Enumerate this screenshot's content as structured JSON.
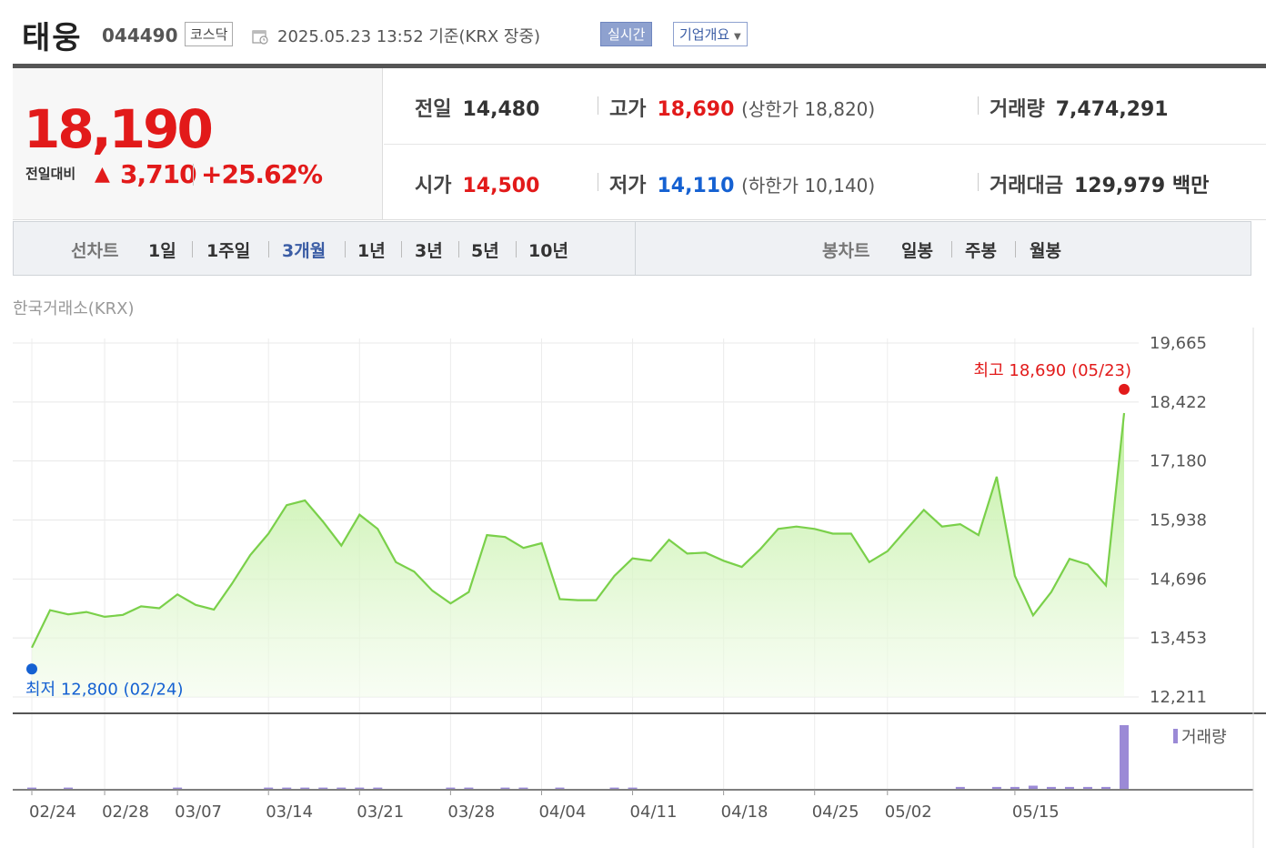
{
  "header": {
    "name": "태웅",
    "code": "044490",
    "market": "코스닥",
    "datetime": "2025.05.23 13:52  기준(KRX 장중)",
    "realtime_label": "실시간",
    "overview_label": "기업개요",
    "icons": [
      "calendar-icon",
      "dropdown-caret-icon"
    ]
  },
  "price": {
    "current": "18,190",
    "compare_label": "전일대비",
    "direction": "up",
    "change": "3,710",
    "rate": "+25.62%"
  },
  "stats": {
    "prev_label": "전일",
    "prev": "14,480",
    "high_label": "고가",
    "high": "18,690",
    "upper_limit": "(상한가 18,820)",
    "volume_label": "거래량",
    "volume": "7,474,291",
    "open_label": "시가",
    "open": "14,500",
    "low_label": "저가",
    "low": "14,110",
    "lower_limit": "(하한가 10,140)",
    "amount_label": "거래대금",
    "amount": "129,979",
    "amount_unit": "백만"
  },
  "line_chart_tabs": {
    "label": "선차트",
    "items": [
      "1일",
      "1주일",
      "3개월",
      "1년",
      "3년",
      "5년",
      "10년"
    ],
    "active": "3개월"
  },
  "candle_chart_tabs": {
    "label": "봉차트",
    "items": [
      "일봉",
      "주봉",
      "월봉"
    ]
  },
  "exchange_label": "한국거래소(KRX)",
  "colors": {
    "up": "#e21a1a",
    "down": "#1561d2",
    "line": "#7ad04a",
    "volume": "#9b8ad6",
    "active_tab": "#3b5da5"
  },
  "chart_data": {
    "type": "line",
    "y_ticks": [
      "19,665",
      "18,422",
      "17,180",
      "15,938",
      "14,696",
      "13,453",
      "12,211"
    ],
    "ylim": [
      12211,
      19665
    ],
    "x_ticks": [
      "02/24",
      "02/28",
      "03/07",
      "03/14",
      "03/21",
      "03/28",
      "04/04",
      "04/11",
      "04/18",
      "04/25",
      "05/02",
      "05/15"
    ],
    "x_tick_index": [
      0,
      4,
      8,
      13,
      18,
      23,
      28,
      33,
      38,
      43,
      47,
      54
    ],
    "max_annotation": "최고 18,690 (05/23)",
    "min_annotation": "최저 12,800 (02/24)",
    "max_value": 18690,
    "min_value": 12800,
    "values": [
      13250,
      14040,
      13950,
      14000,
      13900,
      13940,
      14120,
      14080,
      14370,
      14150,
      14050,
      14600,
      15200,
      15650,
      16250,
      16350,
      15900,
      15400,
      16050,
      15750,
      15050,
      14850,
      14450,
      14180,
      14420,
      15620,
      15580,
      15350,
      15450,
      14270,
      14250,
      14250,
      14760,
      15130,
      15080,
      15520,
      15230,
      15250,
      15080,
      14950,
      15320,
      15750,
      15800,
      15750,
      15650,
      15650,
      15050,
      15280,
      15720,
      16150,
      15800,
      15850,
      15620,
      16850,
      14760,
      13930,
      14420,
      15120,
      15000,
      14560,
      18190
    ],
    "volume_label": "거래량",
    "volume": [
      0.02,
      0,
      0.02,
      0,
      0,
      0,
      0,
      0,
      0.02,
      0,
      0,
      0,
      0,
      0.02,
      0.02,
      0.02,
      0.02,
      0.02,
      0.02,
      0.02,
      0,
      0,
      0,
      0.02,
      0.02,
      0,
      0.02,
      0.02,
      0,
      0.02,
      0,
      0,
      0.02,
      0.02,
      0,
      0,
      0,
      0,
      0,
      0,
      0,
      0,
      0,
      0,
      0,
      0,
      0,
      0,
      0,
      0,
      0,
      0.03,
      0,
      0.03,
      0.03,
      0.05,
      0.03,
      0.03,
      0.03,
      0.03,
      1.0
    ]
  }
}
